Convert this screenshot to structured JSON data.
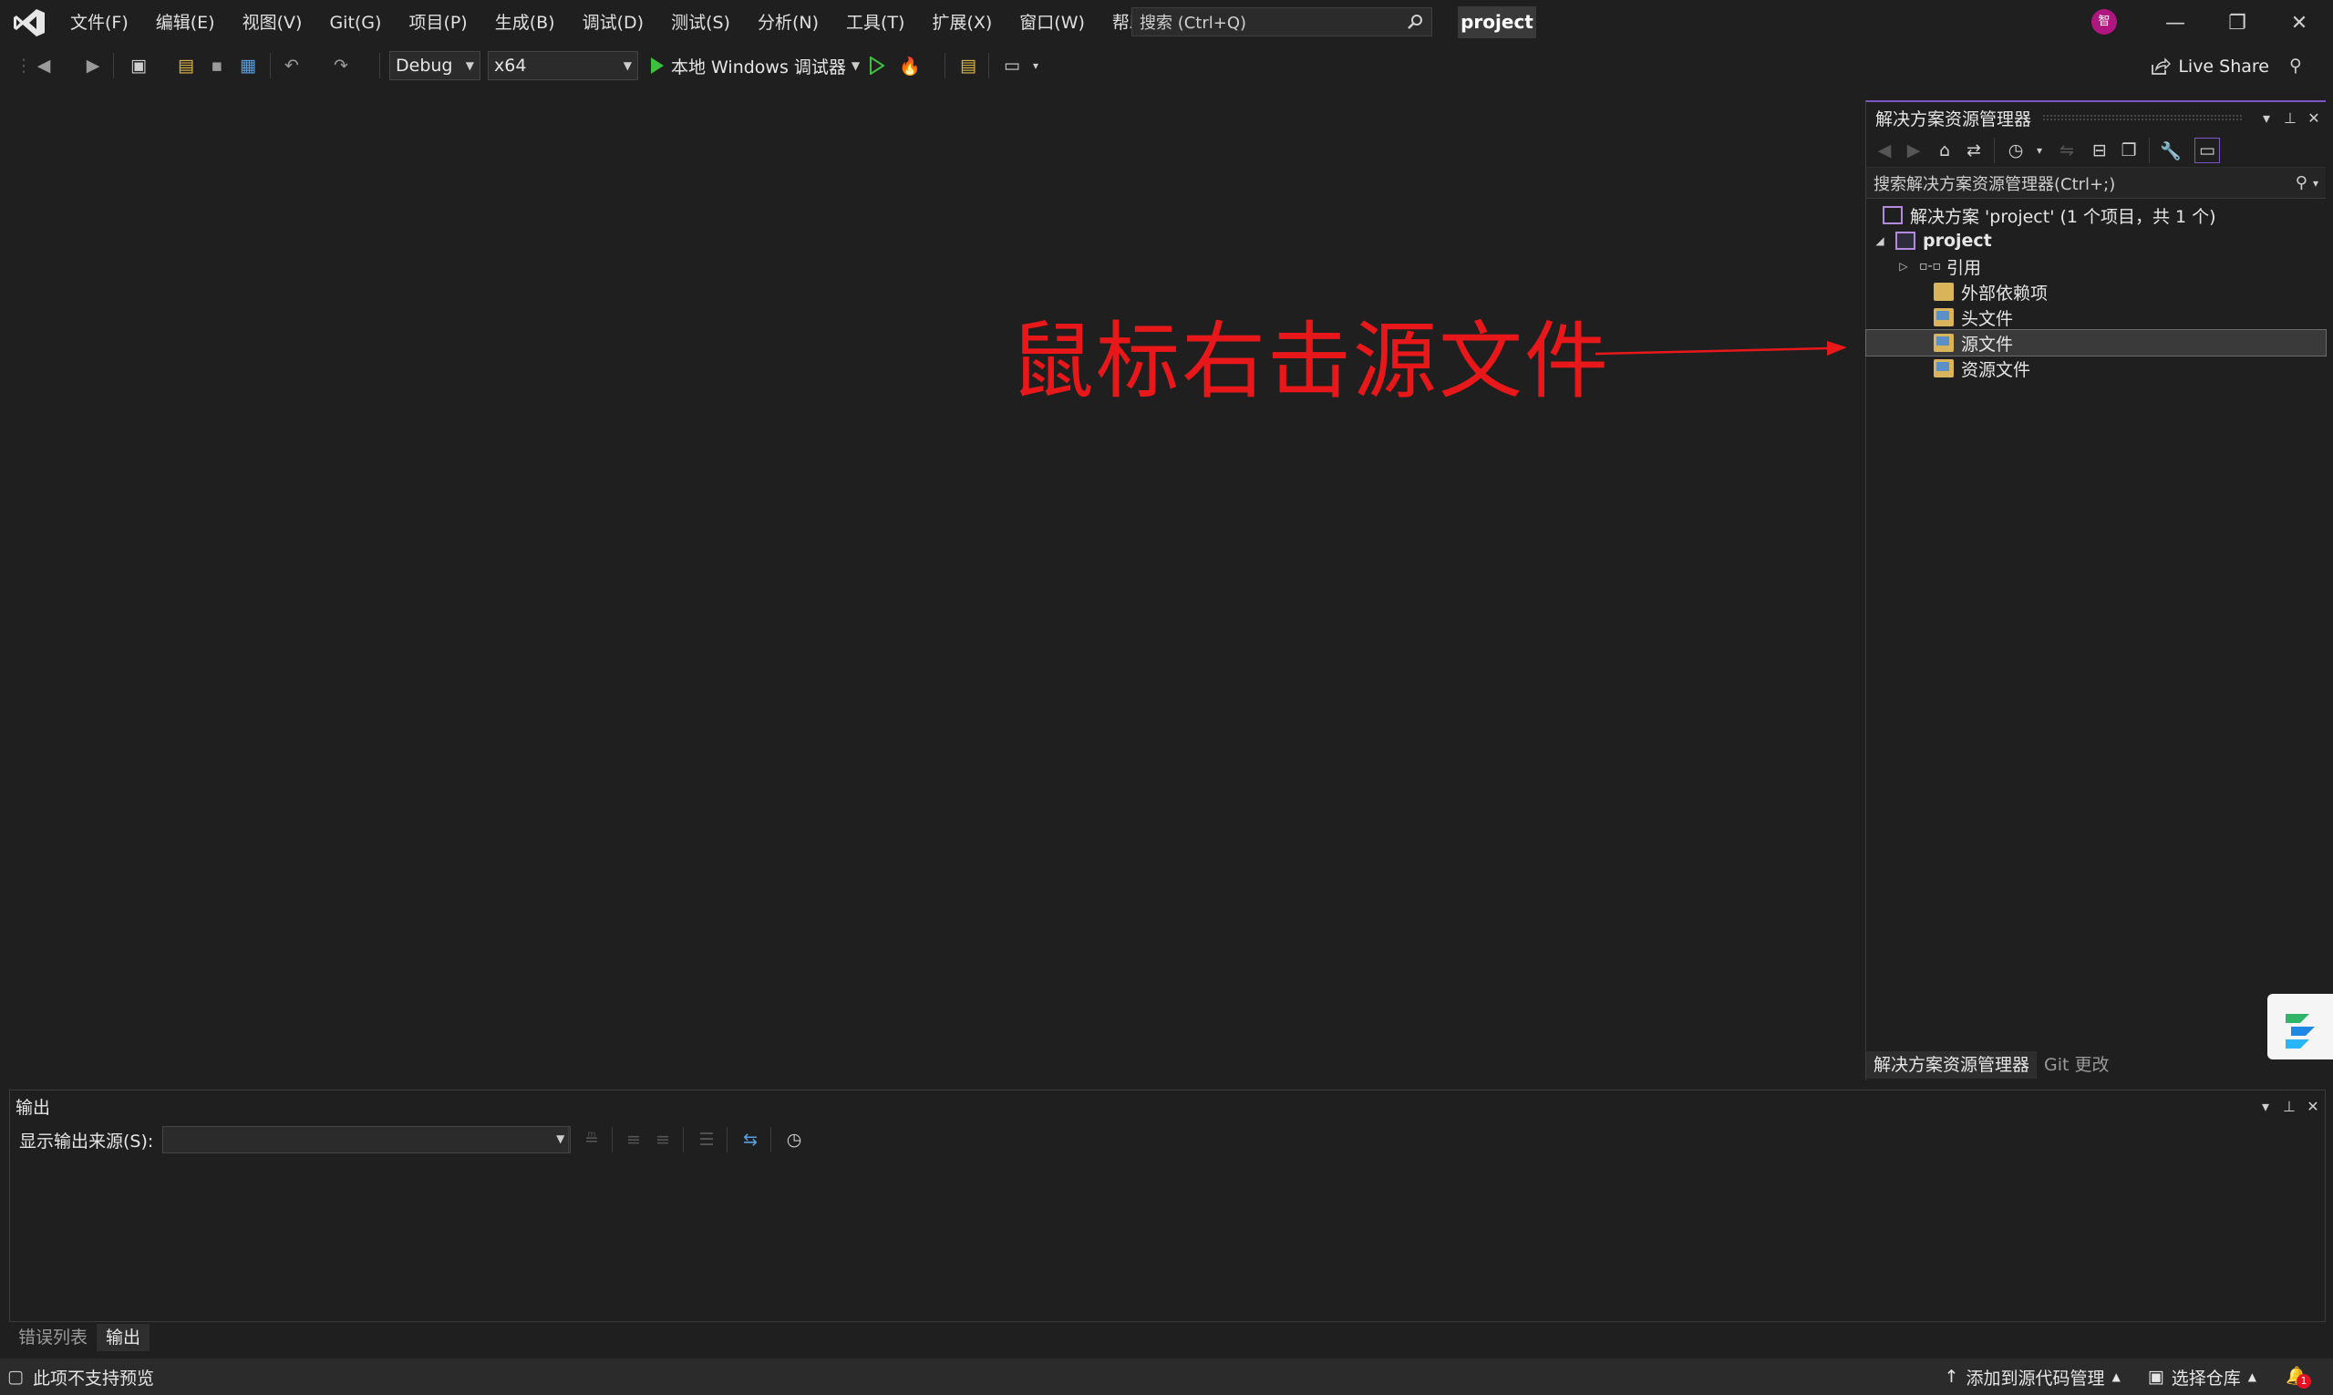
{
  "menu": {
    "items": [
      "文件(F)",
      "编辑(E)",
      "视图(V)",
      "Git(G)",
      "项目(P)",
      "生成(B)",
      "调试(D)",
      "测试(S)",
      "分析(N)",
      "工具(T)",
      "扩展(X)",
      "窗口(W)",
      "帮助(H)"
    ]
  },
  "search": {
    "placeholder": "搜索 (Ctrl+Q)"
  },
  "title": {
    "project": "project",
    "avatar_initial": "智"
  },
  "toolbar": {
    "config": "Debug",
    "platform": "x64",
    "run_label": "本地 Windows 调试器",
    "live_share": "Live Share"
  },
  "annotation": {
    "text": "鼠标右击源文件",
    "color": "#e8181a"
  },
  "solution_explorer": {
    "title": "解决方案资源管理器",
    "search_placeholder": "搜索解决方案资源管理器(Ctrl+;)",
    "tree": {
      "solution": "解决方案 'project' (1 个项目，共 1 个)",
      "project": "project",
      "references": "引用",
      "external_deps": "外部依赖项",
      "header_files": "头文件",
      "source_files": "源文件",
      "resource_files": "资源文件"
    },
    "tabs": [
      "解决方案资源管理器",
      "Git 更改"
    ]
  },
  "output": {
    "title": "输出",
    "source_label": "显示输出来源(S):",
    "source_value": ""
  },
  "bottom_tabs": [
    "错误列表",
    "输出"
  ],
  "statusbar": {
    "preview": "此项不支持预览",
    "add_source_control": "添加到源代码管理",
    "select_repo": "选择仓库",
    "notification_count": "1"
  },
  "colors": {
    "accent": "#7b57c6",
    "background": "#1f1f1f",
    "run_green": "#3fbf3f"
  }
}
